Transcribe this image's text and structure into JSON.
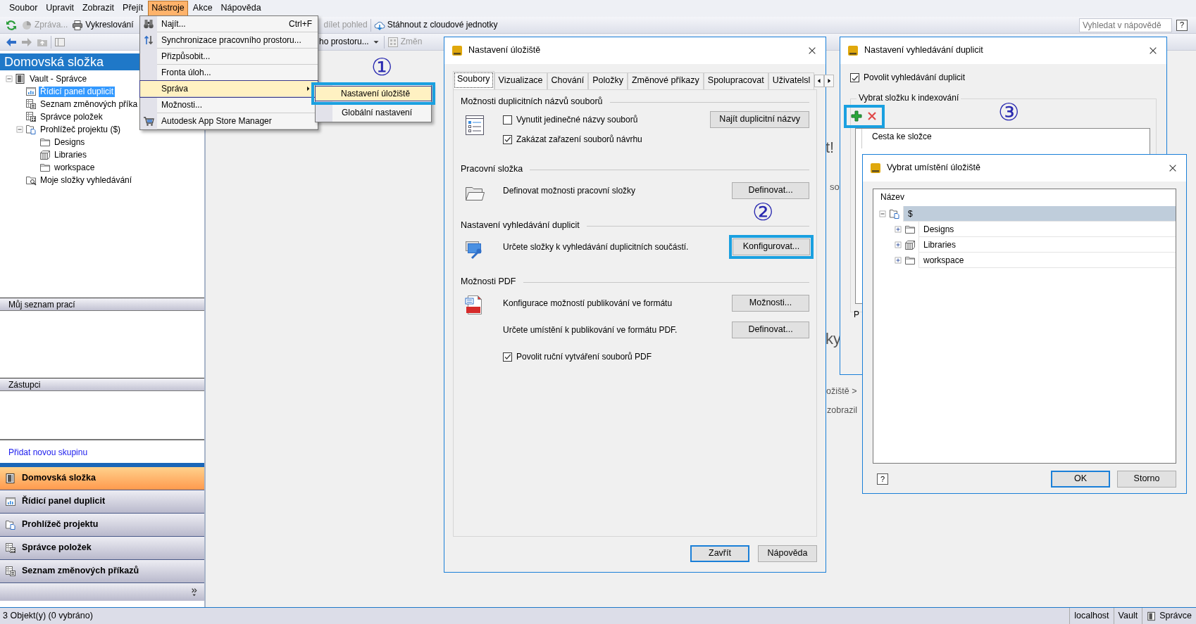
{
  "menu_bar": [
    {
      "label": "Soubor",
      "selected": false
    },
    {
      "label": "Upravit",
      "selected": false
    },
    {
      "label": "Zobrazit",
      "selected": false
    },
    {
      "label": "Přejít",
      "selected": false
    },
    {
      "label": "Nástroje",
      "selected": true
    },
    {
      "label": "Akce",
      "selected": false
    },
    {
      "label": "Nápověda",
      "selected": false
    }
  ],
  "toolbar_1": [
    {
      "label": "Zpráva...",
      "disabled": true
    },
    {
      "label": "Vykreslování",
      "disabled": false
    },
    {
      "label": "dílet pohled",
      "disabled": true
    },
    {
      "label": "Stáhnout z cloudové jednotky",
      "disabled": false
    }
  ],
  "toolbar_2": [
    {
      "kind": "dropdown",
      "label": "ho prostoru...",
      "disabled": false
    },
    {
      "kind": "button",
      "label": "Změn",
      "disabled": true
    }
  ],
  "help_search": {
    "placeholder": "Vyhledat v nápovědě",
    "button": "?"
  },
  "left_panel": {
    "title": "Domovská složka",
    "tree": [
      {
        "label": "Vault - Správce",
        "selected": false,
        "expanded": true,
        "children": [
          {
            "label": "Řídicí panel duplicit",
            "selected": true
          },
          {
            "label": "Seznam změnových příka",
            "selected": false
          },
          {
            "label": "Správce položek",
            "selected": false
          },
          {
            "label": "Prohlížeč projektu ($)",
            "selected": false,
            "expanded": true,
            "children": [
              {
                "label": "Designs",
                "selected": false
              },
              {
                "label": "Libraries",
                "selected": false
              },
              {
                "label": "workspace",
                "selected": false
              }
            ]
          },
          {
            "label": "Moje složky vyhledávání",
            "selected": false
          }
        ]
      }
    ],
    "sections": [
      "Můj seznam prací",
      "Zástupci"
    ],
    "link": "Přidat novou skupinu",
    "nav_buttons": [
      {
        "label": "Domovská složka",
        "selected": true
      },
      {
        "label": "Řídicí panel duplicit",
        "selected": false
      },
      {
        "label": "Prohlížeč projektu",
        "selected": false
      },
      {
        "label": "Správce položek",
        "selected": false
      },
      {
        "label": "Seznam změnových příkazů",
        "selected": false
      }
    ]
  },
  "tools_menu": [
    {
      "label": "Najít...",
      "shortcut": "Ctrl+F",
      "submenu": false,
      "selected": false
    },
    {
      "label": "Synchronizace pracovního prostoru...",
      "submenu": false,
      "selected": false
    },
    {
      "label": "Přizpůsobit...",
      "submenu": false,
      "selected": false
    },
    {
      "label": "Fronta úloh...",
      "submenu": false,
      "selected": false
    },
    {
      "label": "Správa",
      "submenu": true,
      "selected": true
    },
    {
      "label": "Možnosti...",
      "submenu": false,
      "selected": false
    },
    {
      "label": "Autodesk App Store Manager",
      "submenu": false,
      "selected": false
    }
  ],
  "submenu": [
    {
      "label": "Nastavení úložiště",
      "selected": true,
      "highlighted": true
    },
    {
      "label": "Globální nastavení",
      "selected": false,
      "highlighted": false
    }
  ],
  "background_fragments": [
    "t!",
    "so",
    "ky",
    "ožiště >",
    "zobrazil"
  ],
  "vault_settings_dialog": {
    "title": "Nastavení úložiště",
    "tabs": [
      {
        "label": "Soubory",
        "selected": true
      },
      {
        "label": "Vizualizace",
        "selected": false
      },
      {
        "label": "Chování",
        "selected": false
      },
      {
        "label": "Položky",
        "selected": false
      },
      {
        "label": "Změnové příkazy",
        "selected": false
      },
      {
        "label": "Spolupracovat",
        "selected": false
      },
      {
        "label": "Uživatelsl",
        "selected": false
      }
    ],
    "groups": [
      {
        "title": "Možnosti duplicitních názvů souborů",
        "rows": [
          {
            "kind": "checkbox",
            "label": "Vynutit jedinečné názvy souborů",
            "checked": false,
            "button": {
              "label": "Najít duplicitní názvy",
              "highlighted": false
            }
          },
          {
            "kind": "checkbox",
            "label": "Zakázat zařazení souborů návrhu",
            "checked": true
          }
        ]
      },
      {
        "title": "Pracovní složka",
        "rows": [
          {
            "kind": "text",
            "text": "Definovat možnosti pracovní složky",
            "button": {
              "label": "Definovat...",
              "highlighted": false
            }
          }
        ]
      },
      {
        "title": "Nastavení vyhledávání duplicit",
        "rows": [
          {
            "kind": "text",
            "text": "Určete složky k vyhledávání duplicitních součástí.",
            "button": {
              "label": "Konfigurovat...",
              "highlighted": true
            }
          }
        ]
      },
      {
        "title": "Možnosti PDF",
        "rows": [
          {
            "kind": "text",
            "text": "Konfigurace možností publikování ve formátu",
            "button": {
              "label": "Možnosti...",
              "highlighted": false
            }
          },
          {
            "kind": "text",
            "text": "Určete umístění k publikování ve formátu PDF.",
            "button": {
              "label": "Definovat...",
              "highlighted": false
            }
          },
          {
            "kind": "checkbox",
            "label": "Povolit ruční vytváření souborů PDF",
            "checked": true
          }
        ]
      }
    ],
    "buttons": [
      {
        "label": "Zavřít",
        "default": true
      },
      {
        "label": "Nápověda",
        "default": false
      }
    ]
  },
  "duplicate_search_dialog": {
    "title": "Nastavení vyhledávání duplicit",
    "enable": {
      "label": "Povolit vyhledávání duplicit",
      "checked": true
    },
    "group_title": "Vybrat složku k indexování",
    "toolbar_highlighted": true,
    "column": "Cesta ke složce",
    "fragment": "P"
  },
  "location_dialog": {
    "title": "Vybrat umístění úložiště",
    "column": "Název",
    "tree": [
      {
        "label": "$",
        "selected": true,
        "expanded": true,
        "children": [
          {
            "label": "Designs",
            "selected": false,
            "expanded": false
          },
          {
            "label": "Libraries",
            "selected": false,
            "expanded": false
          },
          {
            "label": "workspace",
            "selected": false,
            "expanded": false
          }
        ]
      }
    ],
    "help": "?",
    "buttons": [
      {
        "label": "OK",
        "default": true
      },
      {
        "label": "Storno",
        "default": false
      }
    ]
  },
  "callouts": [
    "①",
    "②",
    "③"
  ],
  "status_bar": {
    "text": "3 Objekt(y) (0 vybráno)",
    "items": [
      "localhost",
      "Vault",
      "Správce"
    ]
  }
}
